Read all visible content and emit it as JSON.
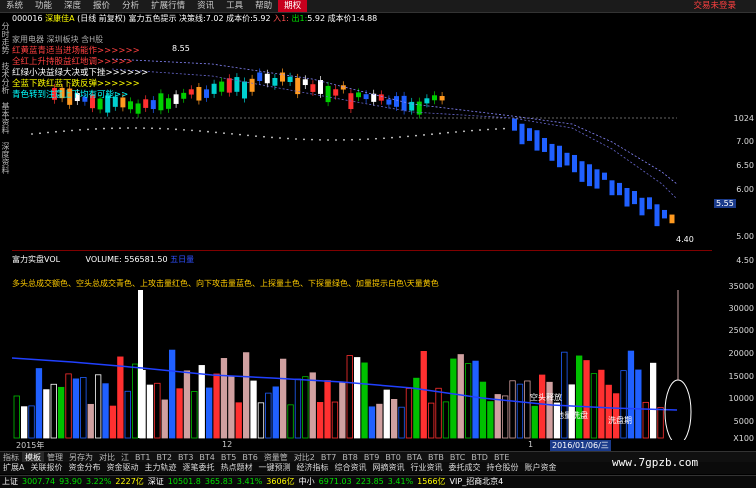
{
  "menu": {
    "items": [
      "系统",
      "功能",
      "深度",
      "报价",
      "分析",
      "扩展行情",
      "资讯",
      "工具",
      "帮助"
    ],
    "active": "期权",
    "right_text": "交易未登录"
  },
  "leftnav": [
    "分时走势",
    "技术分析",
    "基本资料",
    "深度资料"
  ],
  "info": {
    "code": "000016",
    "name": "深康佳A",
    "period": "(日线 前复权)",
    "indicator": "富力五色提示",
    "decision_label": "决策线:",
    "decision_value": "7.02",
    "cost_label": "成本价:",
    "cost_value": "5.92",
    "in_label": "入1:",
    "out_label": "出1:",
    "out_value": "5.92",
    "cost2_label": "成本价1:",
    "cost2_value": "4.88"
  },
  "subtags": "家用电器  深圳板块  含H股",
  "legend": [
    {
      "text": "红黄蓝青适当进场能作>>>>>>",
      "color": "#ff4040"
    },
    {
      "text": "全红上升持股益红地调>>>>>",
      "color": "#ff4040"
    },
    {
      "text": "红绿小决益绿大决或下挫>>>>>>",
      "color": "#ffffff"
    },
    {
      "text": "全蓝下跌红蓝下跌反弹>>>>>>",
      "color": "#ffff00"
    },
    {
      "text": "青色转到注意上下均有可能>>",
      "color": "#00ffff"
    }
  ],
  "price_annotations": {
    "top_value": "8.55",
    "low_value": "4.40"
  },
  "price_axis": [
    "7.00",
    "6.50",
    "6.00",
    "5.50",
    "5.00",
    "4.50"
  ],
  "price_axis_top": "1024",
  "price_axis_current": "5.55",
  "volume": {
    "title": "富力实盘VOL",
    "vol_label": "VOLUME:",
    "vol_value": "556581.50",
    "extra": "五日量",
    "desc": "多头总成交额色、空头总成交青色、上攻击量红色、向下攻击量蓝色、上探量土色、下探量绿色、加量提示白色\\天量黄色",
    "annotation_empty": "空头释放",
    "annotation_low": "地量洗盘",
    "annotation_low2": "洗盘期"
  },
  "volume_axis": [
    "35000",
    "30000",
    "25000",
    "20000",
    "15000",
    "10000",
    "5000"
  ],
  "volume_axis_bottom": "X100",
  "dates": {
    "start": "2015年",
    "mid": "12",
    "end_mark": "1",
    "cursor": "2016/01/06/三"
  },
  "tabs": [
    "指标",
    "模板",
    "管理",
    "另存为",
    "对比",
    "江",
    "BT1",
    "BT2",
    "BT3",
    "BT4",
    "BT5",
    "BT6",
    "资量管",
    "对比2",
    "BT7",
    "BT8",
    "BT9",
    "BT0",
    "BTA",
    "BTB",
    "BTC",
    "BTD",
    "BTE"
  ],
  "tabs_selected": "模板",
  "funcs": [
    "扩展A",
    "关联报价",
    "资金分布",
    "资金驱动",
    "主力轨迹",
    "逐笔委托",
    "热点题材",
    "一键预测",
    "经济指标",
    "综合资讯",
    "网摘资讯",
    "行业资讯",
    "委托成交",
    "持仓股份",
    "账户资金"
  ],
  "status": [
    {
      "text": "上证",
      "color": "#ffffff"
    },
    {
      "text": "3007.74",
      "color": "#00e000"
    },
    {
      "text": "93.90",
      "color": "#00e000"
    },
    {
      "text": "3.22%",
      "color": "#00e000"
    },
    {
      "text": "2227亿",
      "color": "#ffff00"
    },
    {
      "text": "深证",
      "color": "#ffffff"
    },
    {
      "text": "10501.8",
      "color": "#00e000"
    },
    {
      "text": "365.83",
      "color": "#00e000"
    },
    {
      "text": "3.41%",
      "color": "#00e000"
    },
    {
      "text": "3606亿",
      "color": "#ffff00"
    },
    {
      "text": "中小",
      "color": "#ffffff"
    },
    {
      "text": "6971.03",
      "color": "#00e000"
    },
    {
      "text": "223.85",
      "color": "#00e000"
    },
    {
      "text": "3.41%",
      "color": "#00e000"
    },
    {
      "text": "1566亿",
      "color": "#ffff00"
    },
    {
      "text": "VIP_招商北京4",
      "color": "#ffffff"
    }
  ],
  "watermark": "www.7gpzb.com"
}
